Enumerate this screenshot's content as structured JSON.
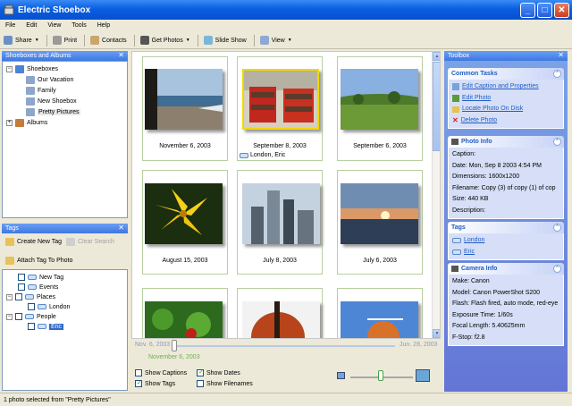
{
  "window": {
    "title": "Electric Shoebox"
  },
  "menu": [
    "File",
    "Edit",
    "View",
    "Tools",
    "Help"
  ],
  "toolbar": {
    "share": "Share",
    "print": "Print",
    "contacts": "Contacts",
    "get_photos": "Get Photos",
    "slideshow": "Slide Show",
    "view": "View"
  },
  "albums_panel": {
    "title": "Shoeboxes and Albums",
    "items": [
      "Shoeboxes",
      "Our Vacation",
      "Family",
      "New Shoebox",
      "Pretty Pictures",
      "Albums"
    ]
  },
  "tags_panel": {
    "title": "Tags",
    "create": "Create New Tag",
    "clear": "Clear Search",
    "attach": "Attach Tag To Photo",
    "items": [
      "New Tag",
      "Events",
      "Places",
      "London",
      "People",
      "Eric"
    ]
  },
  "photos": [
    {
      "date": "November 6, 2003",
      "tags": ""
    },
    {
      "date": "September 8, 2003",
      "tags": "London, Eric"
    },
    {
      "date": "September 6, 2003",
      "tags": ""
    },
    {
      "date": "August 15, 2003",
      "tags": ""
    },
    {
      "date": "July 8, 2003",
      "tags": ""
    },
    {
      "date": "July 6, 2003",
      "tags": ""
    }
  ],
  "timeline": {
    "start": "Nov. 6, 2003",
    "end": "Jun. 28, 2003",
    "current": "November 6, 2003"
  },
  "options": {
    "captions": "Show Captions",
    "dates": "Show Dates",
    "tags": "Show Tags",
    "filenames": "Show Filenames"
  },
  "toolbox": {
    "title": "Toolbox",
    "common_tasks": {
      "title": "Common Tasks",
      "links": [
        "Edit Caption and Properties",
        "Edit Photo",
        "Locate Photo On Disk",
        "Delete Photo"
      ]
    },
    "photo_info": {
      "title": "Photo Info",
      "lines": [
        "Caption:",
        "Date: Mon, Sep 8 2003 4:54 PM",
        "Dimensions: 1600x1200",
        "Filename: Copy  (3) of copy  (1) of cop",
        "Size: 440 KB",
        "Description:"
      ]
    },
    "tags": {
      "title": "Tags",
      "items": [
        "London",
        "Eric"
      ]
    },
    "camera_info": {
      "title": "Camera Info",
      "lines": [
        "Make: Canon",
        "Model: Canon PowerShot S200",
        "Flash: Flash fired, auto mode, red-eye",
        "Exposure Time: 1/60s",
        "Focal Length: 5.40625mm",
        "F-Stop: f2.8"
      ]
    }
  },
  "status": "1 photo selected from \"Pretty Pictures\""
}
